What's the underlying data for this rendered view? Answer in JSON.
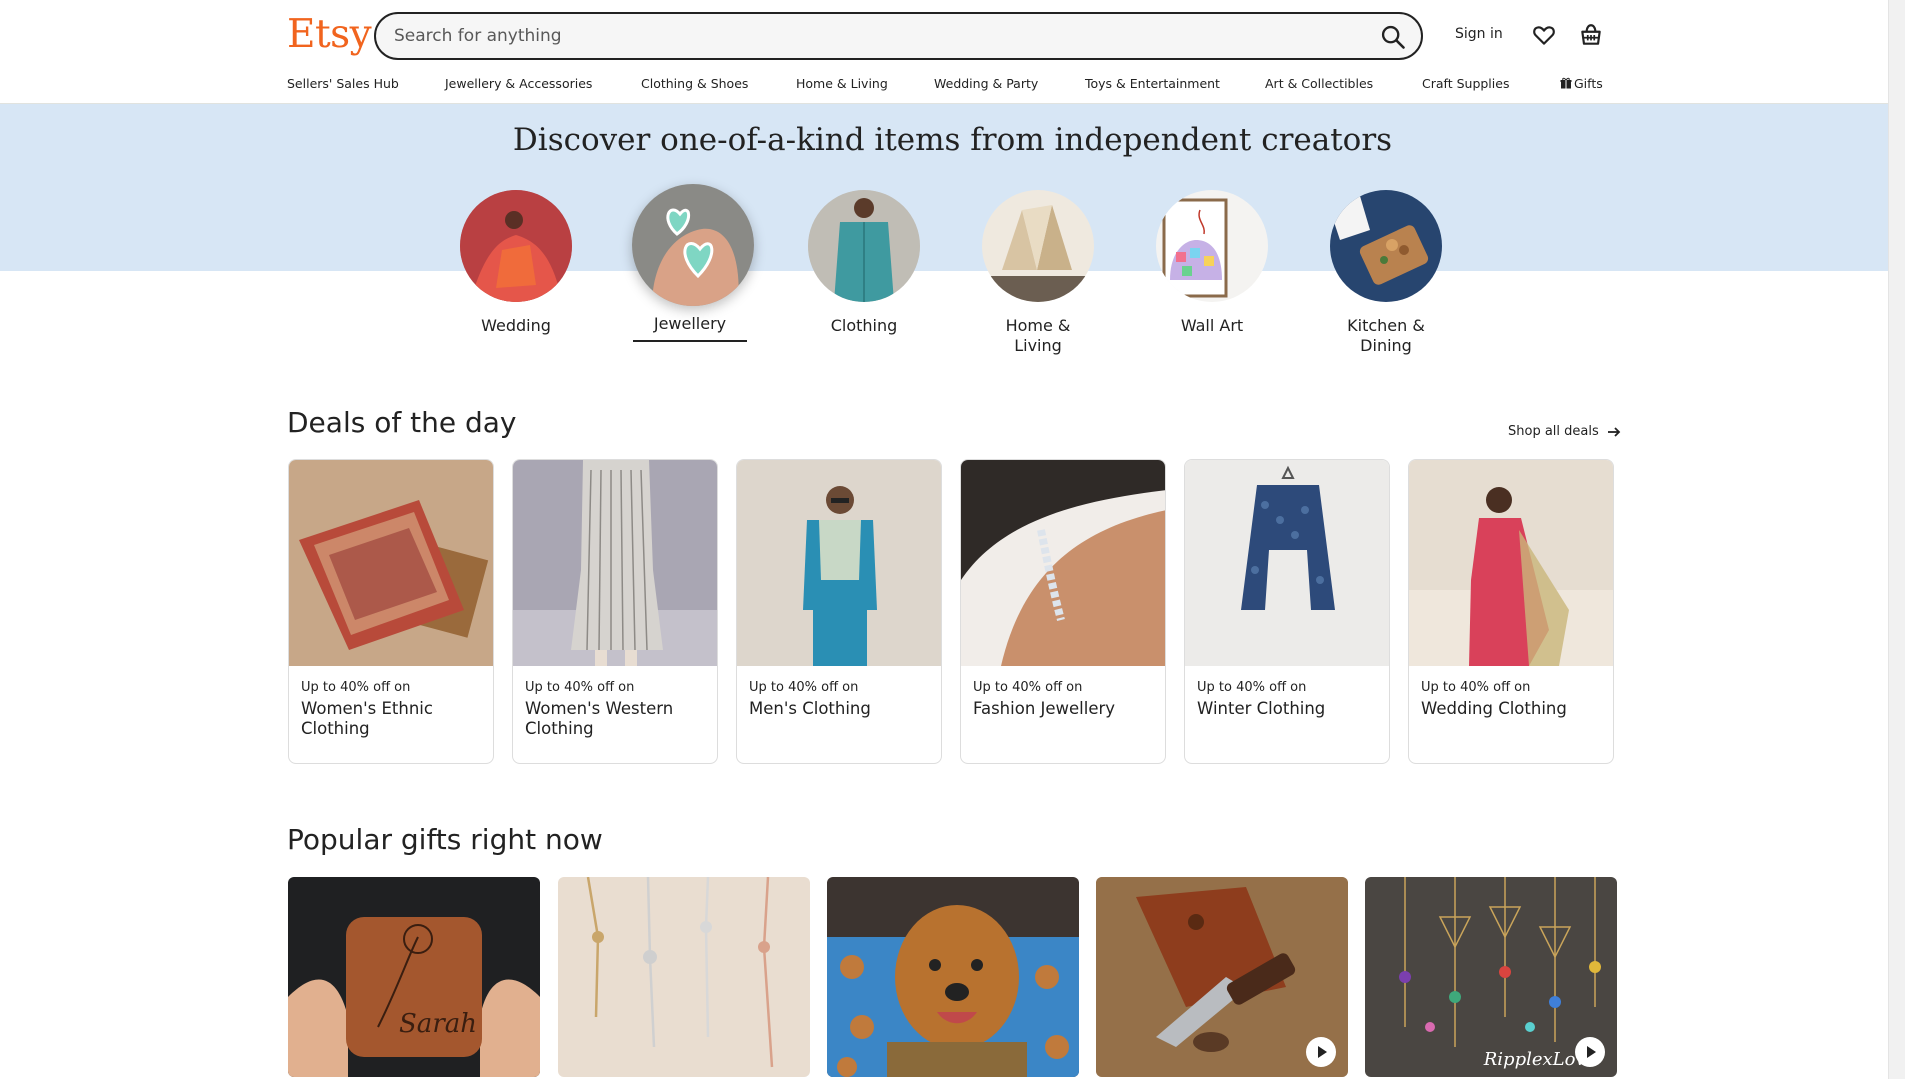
{
  "header": {
    "logo": "Etsy",
    "search_placeholder": "Search for anything",
    "sign_in": "Sign in"
  },
  "nav": [
    "Sellers' Sales Hub",
    "Jewellery & Accessories",
    "Clothing & Shoes",
    "Home & Living",
    "Wedding & Party",
    "Toys & Entertainment",
    "Art & Collectibles",
    "Craft Supplies",
    "Gifts"
  ],
  "hero": {
    "title": "Discover one-of-a-kind items from independent creators",
    "categories": [
      {
        "label": "Wedding"
      },
      {
        "label": "Jewellery",
        "active": true
      },
      {
        "label": "Clothing"
      },
      {
        "label": "Home & Living"
      },
      {
        "label": "Wall Art"
      },
      {
        "label": "Kitchen & Dining"
      }
    ]
  },
  "deals": {
    "title": "Deals of the day",
    "shop_all": "Shop all deals",
    "items": [
      {
        "sub": "Up to 40% off on",
        "name": "Women's Ethnic Clothing"
      },
      {
        "sub": "Up to 40% off on",
        "name": "Women's Western Clothing"
      },
      {
        "sub": "Up to 40% off on",
        "name": "Men's Clothing"
      },
      {
        "sub": "Up to 40% off on",
        "name": "Fashion Jewellery"
      },
      {
        "sub": "Up to 40% off on",
        "name": "Winter Clothing"
      },
      {
        "sub": "Up to 40% off on",
        "name": "Wedding Clothing"
      }
    ]
  },
  "popular": {
    "title": "Popular gifts right now",
    "engraved_name": "Sarah",
    "watermark": "RipplexLove"
  },
  "colors": {
    "brand": "#f1641e",
    "hero_band": "#d7e6f5"
  }
}
